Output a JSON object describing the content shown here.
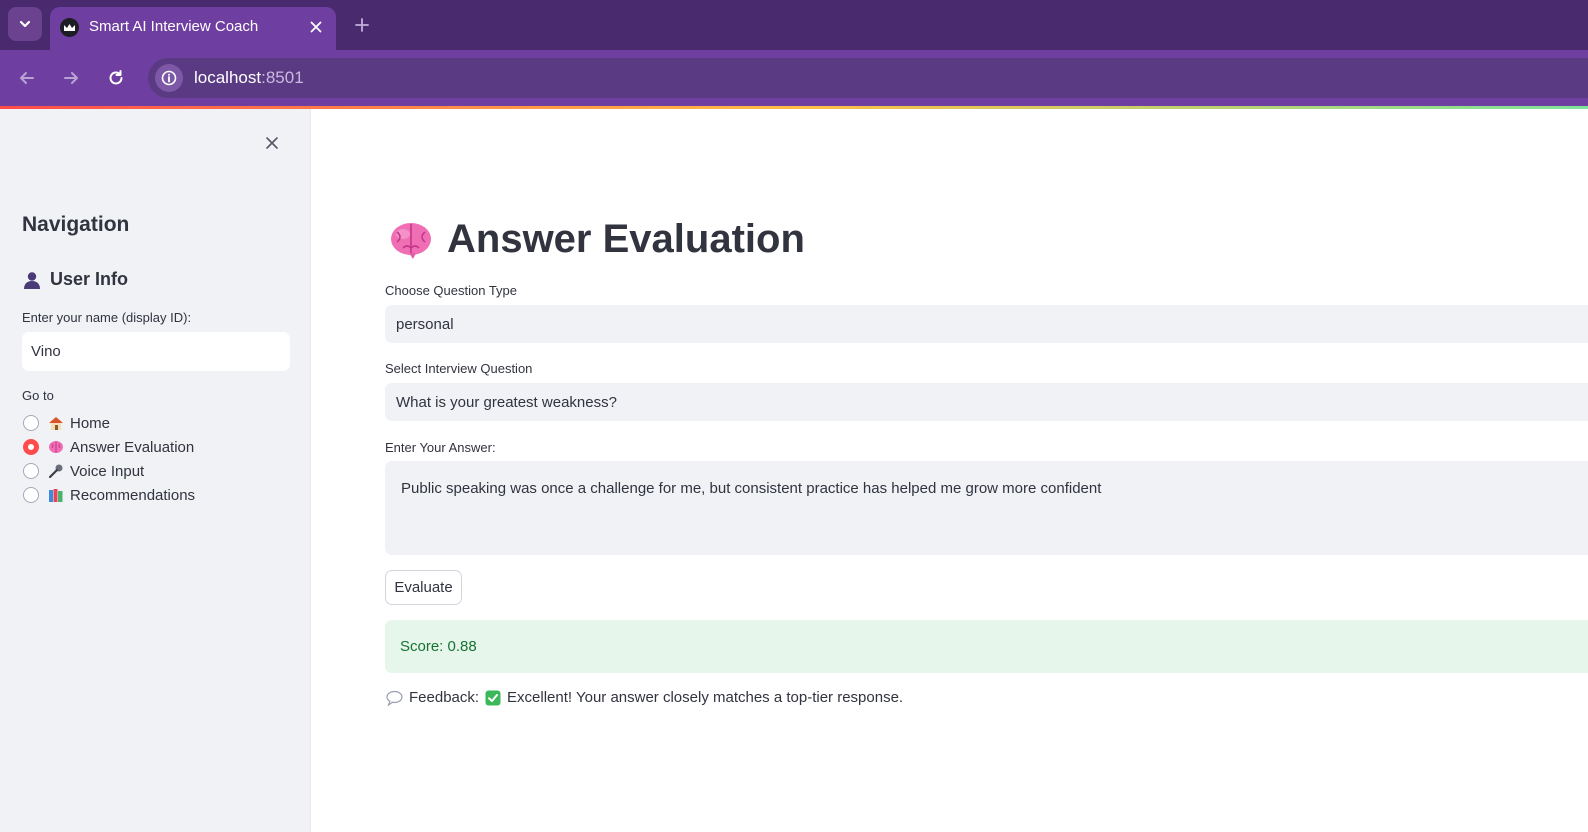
{
  "browser": {
    "tab_title": "Smart AI Interview Coach",
    "url_host": "localhost",
    "url_port": ":8501",
    "icons": {
      "tab_search": "chevron-down-icon",
      "favicon": "crown-icon",
      "tab_close": "close-icon",
      "new_tab": "plus-icon",
      "back": "arrow-left-icon",
      "forward": "arrow-right-icon",
      "reload": "reload-icon",
      "site_info": "info-icon"
    },
    "colors": {
      "tabstrip": "#4a2a6e",
      "toolbar": "#6e3fa0"
    }
  },
  "sidebar": {
    "title": "Navigation",
    "user_info_heading": "User Info",
    "name_label": "Enter your name (display ID):",
    "name_value": "Vino",
    "goto_label": "Go to",
    "items": [
      {
        "label": "Home",
        "icon": "house-icon",
        "selected": false
      },
      {
        "label": "Answer Evaluation",
        "icon": "brain-icon",
        "selected": true
      },
      {
        "label": "Voice Input",
        "icon": "microphone-icon",
        "selected": false
      },
      {
        "label": "Recommendations",
        "icon": "books-icon",
        "selected": false
      }
    ]
  },
  "main": {
    "title": "Answer Evaluation",
    "title_icon": "brain-icon",
    "question_type_label": "Choose Question Type",
    "question_type_value": "personal",
    "question_label": "Select Interview Question",
    "question_value": "What is your greatest weakness?",
    "answer_label": "Enter Your Answer:",
    "answer_value": "Public speaking was once a challenge for me, but consistent practice has helped me grow more confident",
    "evaluate_button": "Evaluate",
    "score_text": "Score: 0.88",
    "feedback_label": "Feedback:",
    "feedback_text": "Excellent! Your answer closely matches a top-tier response.",
    "colors": {
      "accent": "#ff4b4b",
      "success_bg": "#e6f6ea",
      "success_text": "#177233"
    }
  }
}
